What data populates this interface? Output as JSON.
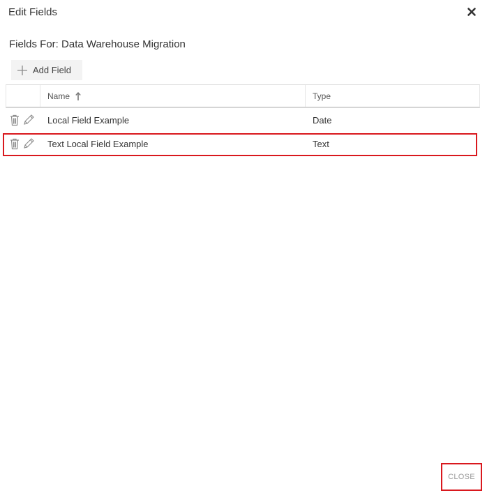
{
  "dialog": {
    "title": "Edit Fields",
    "subtitle": "Fields For: Data Warehouse Migration"
  },
  "toolbar": {
    "add_field_label": "Add Field",
    "add_icon": "plus-icon"
  },
  "grid": {
    "columns": [
      {
        "label": "Name",
        "sorted": "ascending"
      },
      {
        "label": "Type"
      }
    ],
    "rows": [
      {
        "name": "Local Field Example",
        "type": "Date"
      },
      {
        "name": "Text Local Field Example",
        "type": "Text"
      }
    ],
    "row_icons": [
      "trash-icon",
      "pencil-icon"
    ]
  },
  "footer": {
    "close_label": "CLOSE"
  },
  "colors": {
    "highlight": "#d9181e",
    "button_bg": "#f3f3f3",
    "muted_text": "#9a9a9a"
  }
}
